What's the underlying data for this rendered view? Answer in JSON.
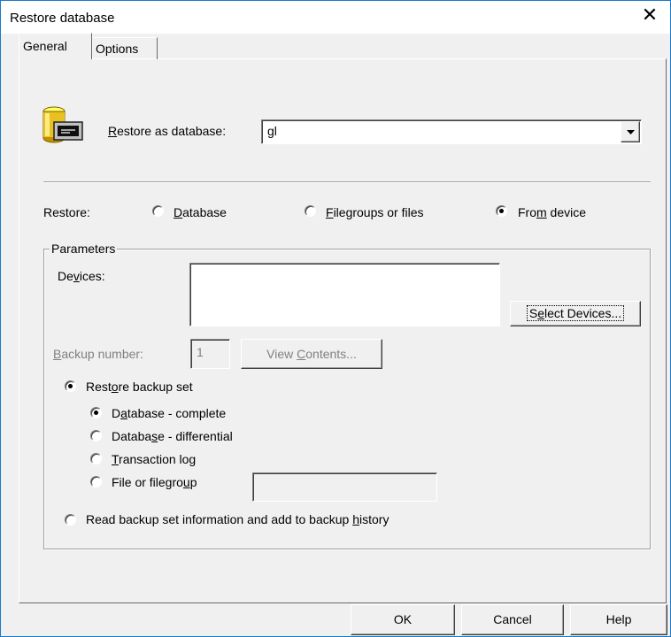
{
  "window": {
    "title": "Restore database",
    "close_glyph": "✕"
  },
  "tabs": [
    {
      "label": "General",
      "active": true
    },
    {
      "label": "Options",
      "active": false
    }
  ],
  "restore_as": {
    "label_pre": "",
    "label_ul": "R",
    "label_post": "estore as database:",
    "value": "gl"
  },
  "restore": {
    "label": "Restore:",
    "options": [
      {
        "pre": "",
        "ul": "D",
        "post": "atabase",
        "selected": false
      },
      {
        "pre": "",
        "ul": "F",
        "post": "ilegroups or files",
        "selected": false
      },
      {
        "pre": "Fro",
        "ul": "m",
        "post": " device",
        "selected": true
      }
    ]
  },
  "parameters": {
    "title": "Parameters",
    "devices_label_pre": "De",
    "devices_label_ul": "v",
    "devices_label_post": "ices:",
    "select_devices_pre": "S",
    "select_devices_ul": "e",
    "select_devices_post": "lect Devices...",
    "backup_number_ul": "B",
    "backup_number_post": "ackup number:",
    "backup_number_value": "1",
    "view_contents_pre": "View ",
    "view_contents_ul": "C",
    "view_contents_post": "ontents...",
    "restore_backup_set": {
      "pre": "Rest",
      "ul": "o",
      "post": "re backup set",
      "selected": true
    },
    "set_options": [
      {
        "pre": "D",
        "ul": "a",
        "post": "tabase - complete",
        "selected": true
      },
      {
        "pre": "Databa",
        "ul": "s",
        "post": "e - differential",
        "selected": false
      },
      {
        "pre": "",
        "ul": "T",
        "post": "ransaction log",
        "selected": false
      },
      {
        "pre": "File or filegro",
        "ul": "u",
        "post": "p",
        "selected": false
      }
    ],
    "read_backup": {
      "pre": "Read backup set information and add to backup ",
      "ul": "h",
      "post": "istory",
      "selected": false
    }
  },
  "buttons": {
    "ok": "OK",
    "cancel": "Cancel",
    "help": "Help"
  },
  "colors": {
    "accent_border": "#1979ca",
    "face": "#f0f0f0"
  },
  "icons": {
    "database": "database-icon"
  }
}
